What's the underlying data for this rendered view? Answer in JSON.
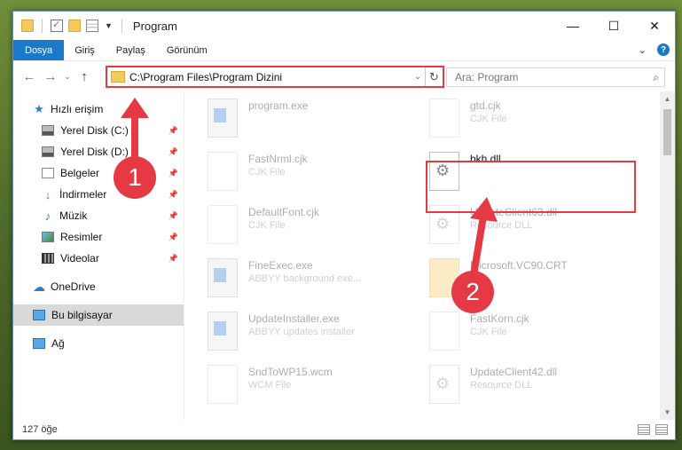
{
  "window": {
    "title": "Program",
    "controls": {
      "minimize": "—",
      "maximize": "☐",
      "close": "✕"
    }
  },
  "ribbon": {
    "tabs": [
      "Dosya",
      "Giriş",
      "Paylaş",
      "Görünüm"
    ],
    "expand": "⌄",
    "help": "?"
  },
  "nav": {
    "back": "←",
    "forward": "→",
    "recent": "⌄",
    "up": "↑"
  },
  "address": {
    "path": "C:\\Program Files\\Program Dizini",
    "dropdown": "⌄",
    "refresh": "↻"
  },
  "search": {
    "placeholder": "Ara: Program",
    "icon": "⌕"
  },
  "sidebar": {
    "quick_access": "Hızlı erişim",
    "items": [
      {
        "label": "Yerel Disk (C:)",
        "icon": "disk-icon",
        "pinned": true
      },
      {
        "label": "Yerel Disk (D:)",
        "icon": "disk-icon",
        "pinned": true
      },
      {
        "label": "Belgeler",
        "icon": "documents-icon",
        "pinned": true
      },
      {
        "label": "İndirmeler",
        "icon": "download-icon",
        "pinned": true
      },
      {
        "label": "Müzik",
        "icon": "music-icon",
        "pinned": true
      },
      {
        "label": "Resimler",
        "icon": "pictures-icon",
        "pinned": true
      },
      {
        "label": "Videolar",
        "icon": "videos-icon",
        "pinned": true
      }
    ],
    "onedrive": "OneDrive",
    "this_pc": "Bu bilgisayar",
    "network": "Ağ",
    "pin_glyph": "📌"
  },
  "files": [
    {
      "name": "program.exe",
      "type": "",
      "icon": "exe-icon"
    },
    {
      "name": "gtd.cjk",
      "type": "CJK File",
      "icon": "doc-icon"
    },
    {
      "name": "FastNrml.cjk",
      "type": "CJK File",
      "icon": "doc-icon"
    },
    {
      "name": "bkh.dll",
      "type": "",
      "icon": "dll-icon"
    },
    {
      "name": "DefaultFont.cjk",
      "type": "CJK File",
      "icon": "doc-icon"
    },
    {
      "name": "UpdateClient63.dll",
      "type": "Resource DLL",
      "icon": "dll-icon"
    },
    {
      "name": "FineExec.exe",
      "type": "ABBYY background exe...",
      "icon": "exe-icon"
    },
    {
      "name": "Microsoft.VC90.CRT",
      "type": "",
      "icon": "folder-icon"
    },
    {
      "name": "UpdateInstaller.exe",
      "type": "ABBYY updates installer",
      "icon": "exe-icon"
    },
    {
      "name": "FastKorn.cjk",
      "type": "CJK File",
      "icon": "doc-icon"
    },
    {
      "name": "SndToWP15.wcm",
      "type": "WCM File",
      "icon": "doc-icon"
    },
    {
      "name": "UpdateClient42.dll",
      "type": "Resource DLL",
      "icon": "dll-icon"
    }
  ],
  "status": {
    "count": "127 öğe"
  },
  "annotations": {
    "step1": "1",
    "step2": "2"
  },
  "colors": {
    "accent": "#1979ca",
    "annotation": "#e53944"
  }
}
